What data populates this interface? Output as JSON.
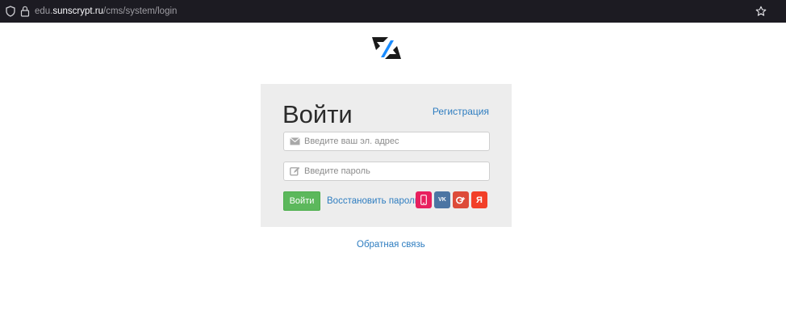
{
  "browser": {
    "url_prefix": "edu.",
    "url_domain": "sunscrypt.ru",
    "url_path": "/cms/system/login"
  },
  "login": {
    "title": "Войти",
    "register_link": "Регистрация",
    "email_placeholder": "Введите ваш эл. адрес",
    "password_placeholder": "Введите пароль",
    "login_button": "Войти",
    "restore_link": "Восстановить пароль",
    "social": [
      {
        "name": "phone-icon",
        "color": "#e8205e"
      },
      {
        "name": "vk-icon",
        "label": "VK",
        "color": "#4c75a3"
      },
      {
        "name": "google-plus-icon",
        "color": "#dd4b39"
      },
      {
        "name": "yandex-icon",
        "label": "Я",
        "color": "#f23f28"
      }
    ]
  },
  "footer": {
    "feedback_link": "Обратная связь"
  },
  "colors": {
    "accent_link": "#2e7dc0",
    "button_green": "#5cb85c",
    "card_bg": "#ededed",
    "logo_blue": "#1a8cff"
  }
}
